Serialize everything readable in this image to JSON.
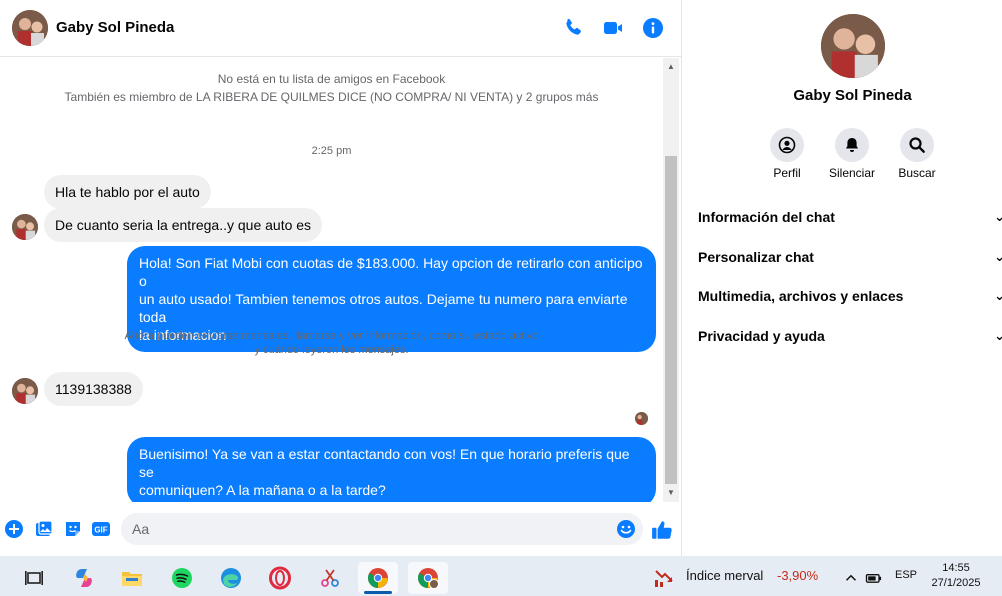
{
  "header": {
    "contact_name": "Gaby Sol Pineda",
    "icons": [
      "phone-icon",
      "video-camera-icon",
      "info-icon"
    ],
    "accent_color": "#0a7cff"
  },
  "conversation": {
    "context_line_1": "No está en tu lista de amigos en Facebook",
    "context_line_2": "También es miembro de LA RIBERA DE QUILMES DICE (NO COMPRA/ NI VENTA) y 2 grupos más",
    "timestamp": "2:25 pm",
    "msg_in_1": "Hla te hablo por el auto",
    "msg_in_2": "De cuanto seria la entrega..y que auto es",
    "msg_out_1_line1": "Hola! Son Fiat Mobi con cuotas de $183.000. Hay opcion de retirarlo con anticipo o",
    "msg_out_1_line2": "un auto usado! Tambien tenemos otros autos. Dejame tu numero para enviarte toda",
    "msg_out_1_line3": "la informacion",
    "system_notice_line1": "Ahora pueden enviarse mensajes, llamarse y ver información, como su estado activo",
    "system_notice_line2": "y cuándo leyeron los mensajes.",
    "msg_in_3": "1139138388",
    "msg_out_2_line1": "Buenisimo! Ya se van a estar contactando con vos! En que horario preferis que se",
    "msg_out_2_line2": "comuniquen? A la mañana o a la tarde?"
  },
  "composer": {
    "placeholder": "Aa",
    "icons": [
      "plus-icon",
      "image-icon",
      "sticker-icon",
      "gif-icon",
      "emoji-icon",
      "thumbs-up-icon"
    ],
    "gif_label": "GIF"
  },
  "side_panel": {
    "contact_name": "Gaby Sol Pineda",
    "actions": [
      {
        "label": "Perfil",
        "icon": "profile-icon"
      },
      {
        "label": "Silenciar",
        "icon": "bell-icon"
      },
      {
        "label": "Buscar",
        "icon": "search-icon"
      }
    ],
    "sections": [
      {
        "label": "Información del chat"
      },
      {
        "label": "Personalizar chat"
      },
      {
        "label": "Multimedia, archivos y enlaces"
      },
      {
        "label": "Privacidad y ayuda"
      }
    ]
  },
  "taskbar": {
    "apps": [
      "task-view-icon",
      "copilot-icon",
      "file-explorer-icon",
      "spotify-icon",
      "edge-icon",
      "opera-icon",
      "snipping-tool-icon",
      "chrome-icon",
      "chrome-profile-icon"
    ],
    "stock_label": "Índice merval",
    "stock_change": "-3,90%",
    "language": "ESP",
    "time": "14:55",
    "date": "27/1/2025"
  }
}
